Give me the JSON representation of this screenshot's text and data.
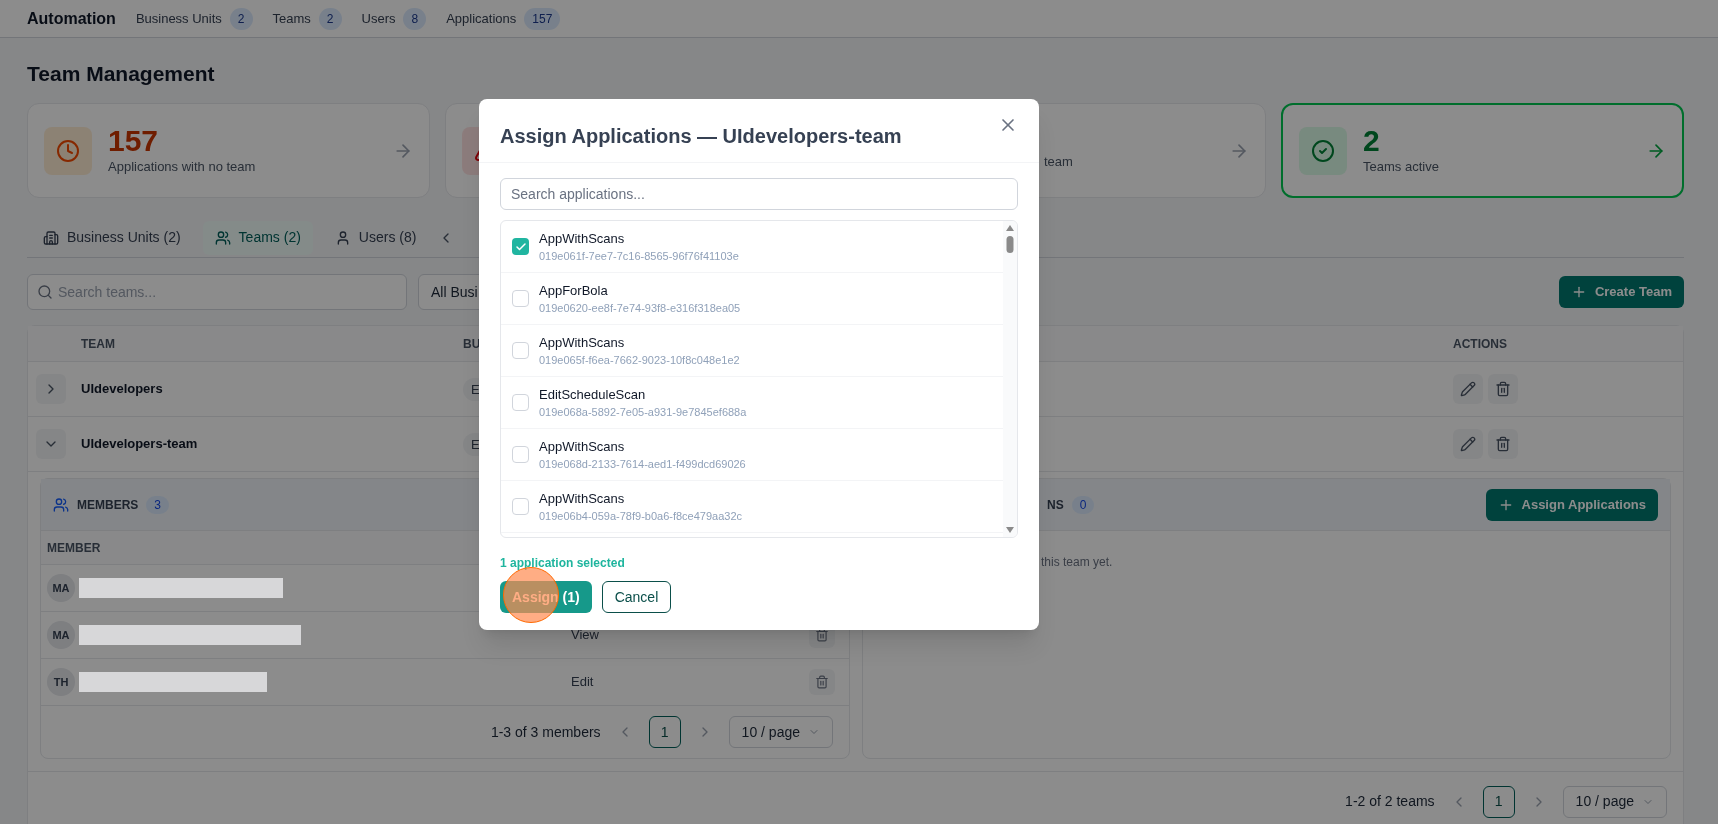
{
  "nav": {
    "brand": "Automation",
    "items": [
      {
        "label": "Business Units",
        "count": "2"
      },
      {
        "label": "Teams",
        "count": "2"
      },
      {
        "label": "Users",
        "count": "8"
      },
      {
        "label": "Applications",
        "count": "157"
      }
    ]
  },
  "page_title": "Team Management",
  "stat_cards": [
    {
      "kind": "warning",
      "value": "157",
      "label": "Applications with no team",
      "selected": false
    },
    {
      "kind": "danger",
      "selected": false
    },
    {
      "kind": "neutral",
      "label": "team",
      "selected": false
    },
    {
      "kind": "success",
      "value": "2",
      "label": "Teams active",
      "selected": true
    }
  ],
  "tabs": [
    {
      "label": "Business Units (2)",
      "selected": false
    },
    {
      "label": "Teams (2)",
      "selected": true
    },
    {
      "label": "Users (8)",
      "selected": false
    }
  ],
  "search": {
    "placeholder": "Search teams..."
  },
  "filter": {
    "value": "All Busi"
  },
  "create_button": "Create Team",
  "table": {
    "columns": [
      "TEAM",
      "BU",
      "ACTIONS"
    ],
    "rows": [
      {
        "name": "UIdevelopers",
        "column_2": "E",
        "expanded": false
      },
      {
        "name": "UIdevelopers-team",
        "column_2": "E",
        "expanded": true
      }
    ]
  },
  "members": {
    "title": "MEMBERS",
    "count": "3",
    "columns": [
      "MEMBER"
    ],
    "rows": [
      {
        "initials": "MA"
      },
      {
        "initials": "MA",
        "role": "View"
      },
      {
        "initials": "TH",
        "role": "Edit"
      }
    ],
    "pagination": {
      "summary": "1-3 of 3 members",
      "page": "1",
      "page_size": "10 / page"
    }
  },
  "applications": {
    "title": "NS",
    "count": "0",
    "button": "Assign Applications",
    "empty_text": "this team yet."
  },
  "pagination": {
    "summary": "1-2 of 2 teams",
    "page": "1",
    "page_size": "10 / page"
  },
  "modal": {
    "title": "Assign Applications — UIdevelopers-team",
    "search_placeholder": "Search applications...",
    "apps": [
      {
        "name": "AppWithScans",
        "id": "019e061f-7ee7-7c16-8565-96f76f41103e",
        "checked": true
      },
      {
        "name": "AppForBola",
        "id": "019e0620-ee8f-7e74-93f8-e316f318ea05",
        "checked": false
      },
      {
        "name": "AppWithScans",
        "id": "019e065f-f6ea-7662-9023-10f8c048e1e2",
        "checked": false
      },
      {
        "name": "EditScheduleScan",
        "id": "019e068a-5892-7e05-a931-9e7845ef688a",
        "checked": false
      },
      {
        "name": "AppWithScans",
        "id": "019e068d-2133-7614-aed1-f499dcd69026",
        "checked": false
      },
      {
        "name": "AppWithScans",
        "id": "019e06b4-059a-78f9-b0a6-f8ce479aa32c",
        "checked": false
      }
    ],
    "selected_text": "1 application selected",
    "assign_button": "Assign (1)",
    "cancel_button": "Cancel"
  }
}
